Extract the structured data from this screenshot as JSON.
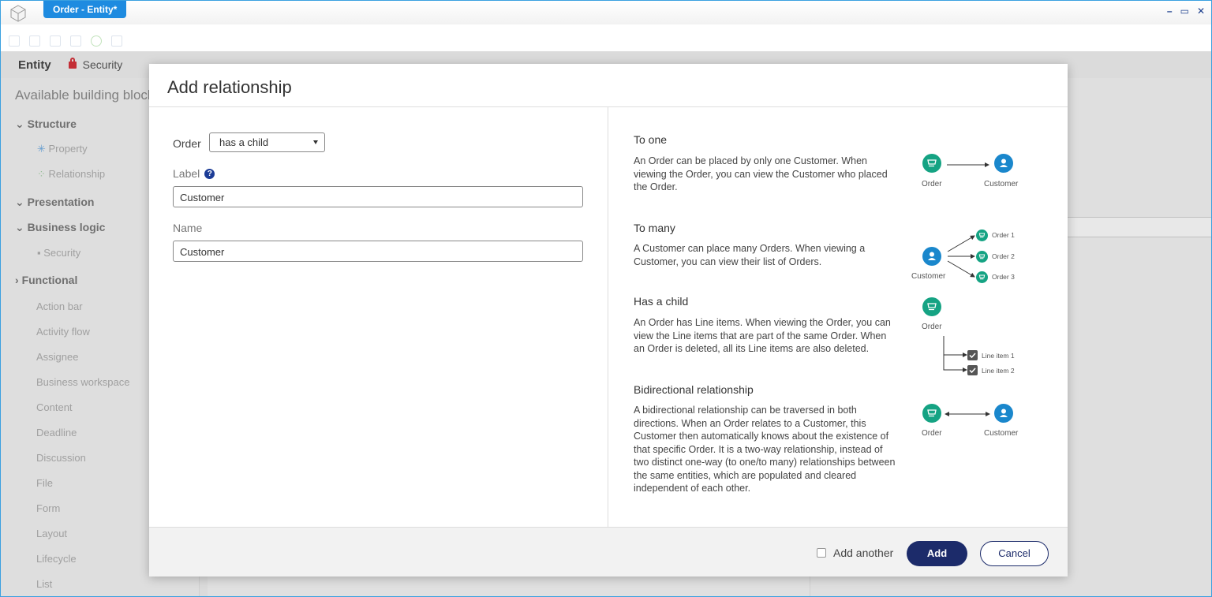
{
  "window": {
    "title": "Order - Entity*",
    "controls": [
      "–",
      "▭",
      "✕"
    ]
  },
  "background": {
    "tabs": {
      "entity": "Entity",
      "security": "Security"
    },
    "sidebar": {
      "heading": "Available building blocks",
      "groups": {
        "structure": "Structure",
        "presentation": "Presentation",
        "business_logic": "Business logic",
        "functional": "Functional"
      },
      "structure_items": [
        "Property",
        "Relationship"
      ],
      "business_items": [
        "Security"
      ],
      "functional_items": [
        "Action bar",
        "Activity flow",
        "Assignee",
        "Business workspace",
        "Content",
        "Deadline",
        "Discussion",
        "File",
        "Form",
        "Layout",
        "Lifecycle",
        "List"
      ]
    }
  },
  "modal": {
    "title": "Add relationship",
    "form": {
      "order_label": "Order",
      "relationship_value": "has a child",
      "label_label": "Label",
      "label_value": "Customer",
      "name_label": "Name",
      "name_value": "Customer"
    },
    "help_sections": [
      {
        "title": "To one",
        "text": "An Order can be placed by only one Customer. When viewing the Order, you can view the Customer who placed the Order."
      },
      {
        "title": "To many",
        "text": "A Customer can place many Orders. When viewing a Customer, you can view their list of Orders."
      },
      {
        "title": "Has a child",
        "text": "An Order has Line items. When viewing the Order, you can view the Line items that are part of the same Order. When an Order is deleted, all its Line items are also deleted."
      },
      {
        "title": "Bidirectional relationship",
        "text": "A bidirectional relationship can be traversed in both directions. When an Order relates to a Customer, this Customer then automatically knows about the existence of that specific Order. It is a two-way relationship, instead of two distinct one-way (to one/to many) relationships between the same entities, which are populated and cleared independent of each other."
      }
    ],
    "diagrams": {
      "to_one": {
        "from": "Order",
        "to": "Customer"
      },
      "to_many": {
        "from": "Customer",
        "targets": [
          "Order 1",
          "Order 2",
          "Order 3"
        ]
      },
      "has_child": {
        "parent": "Order",
        "children": [
          "Line item 1",
          "Line item 2"
        ]
      },
      "bidirectional": {
        "a": "Order",
        "b": "Customer"
      }
    },
    "footer": {
      "add_another": "Add another",
      "add": "Add",
      "cancel": "Cancel"
    }
  },
  "icons": {
    "order": "cart-icon",
    "customer": "person-icon",
    "line_item": "checkbox-icon"
  },
  "colors": {
    "order_green": "#15a383",
    "customer_blue": "#1a87cc",
    "primary_button": "#1c2b6a",
    "title_tab": "#1e8be0"
  }
}
